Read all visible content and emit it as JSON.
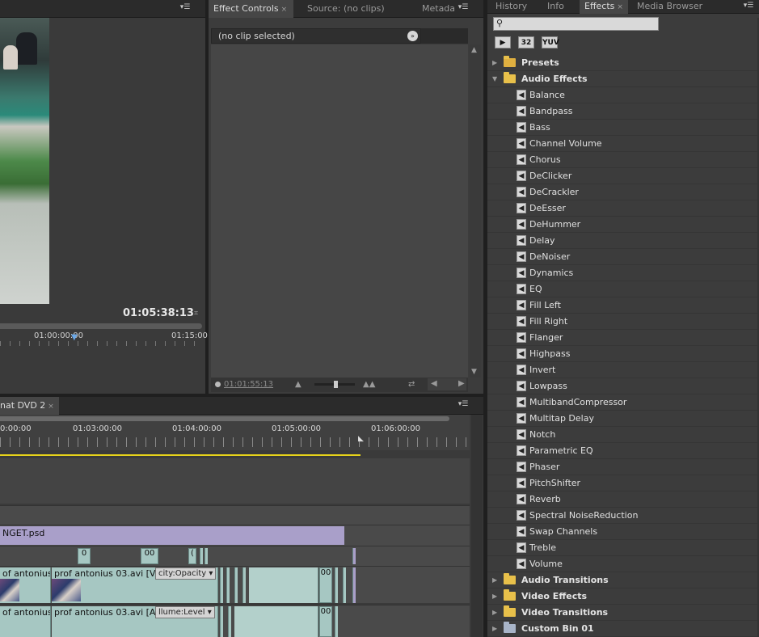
{
  "program": {
    "timecode": "01:05:38:13",
    "ruler_labels": [
      "01:00:00:00",
      "01:15:00"
    ]
  },
  "effect_controls": {
    "tabs": [
      {
        "label": "Effect Controls",
        "close": "×"
      },
      {
        "label": "Source: (no clips)"
      },
      {
        "label": "Metada"
      }
    ],
    "clip_header": "(no clip selected)",
    "footer_time": "01:01:55:13"
  },
  "timeline": {
    "tab_label": "nat DVD 2",
    "tab_close": "×",
    "ruler_labels": [
      "0:00:00",
      "01:03:00:00",
      "01:04:00:00",
      "01:05:00:00",
      "01:06:00:00"
    ],
    "graphic_clip": "NGET.psd",
    "mini_clips": [
      "0",
      "00",
      "("
    ],
    "video_clips": [
      "of antonius",
      "prof antonius 03.avi [V]"
    ],
    "video_dropdown": "city:Opacity",
    "video_mini": [
      "00"
    ],
    "audio_clips": [
      "of antonius",
      "prof antonius 03.avi [A]"
    ],
    "audio_dropdown": "llume:Level",
    "audio_mini": [
      "00"
    ]
  },
  "effects": {
    "tabs": [
      {
        "label": "History"
      },
      {
        "label": "Info"
      },
      {
        "label": "Effects",
        "close": "×"
      },
      {
        "label": "Media Browser"
      }
    ],
    "search_value": "",
    "filter_buttons": [
      "32",
      "YUV"
    ],
    "tree": {
      "presets": "Presets",
      "audio_effects": "Audio Effects",
      "audio_effects_items": [
        "Balance",
        "Bandpass",
        "Bass",
        "Channel Volume",
        "Chorus",
        "DeClicker",
        "DeCrackler",
        "DeEsser",
        "DeHummer",
        "Delay",
        "DeNoiser",
        "Dynamics",
        "EQ",
        "Fill Left",
        "Fill Right",
        "Flanger",
        "Highpass",
        "Invert",
        "Lowpass",
        "MultibandCompressor",
        "Multitap Delay",
        "Notch",
        "Parametric EQ",
        "Phaser",
        "PitchShifter",
        "Reverb",
        "Spectral NoiseReduction",
        "Swap Channels",
        "Treble",
        "Volume"
      ],
      "audio_transitions": "Audio Transitions",
      "video_effects": "Video Effects",
      "video_transitions": "Video Transitions",
      "custom_bin": "Custom Bin 01"
    }
  }
}
